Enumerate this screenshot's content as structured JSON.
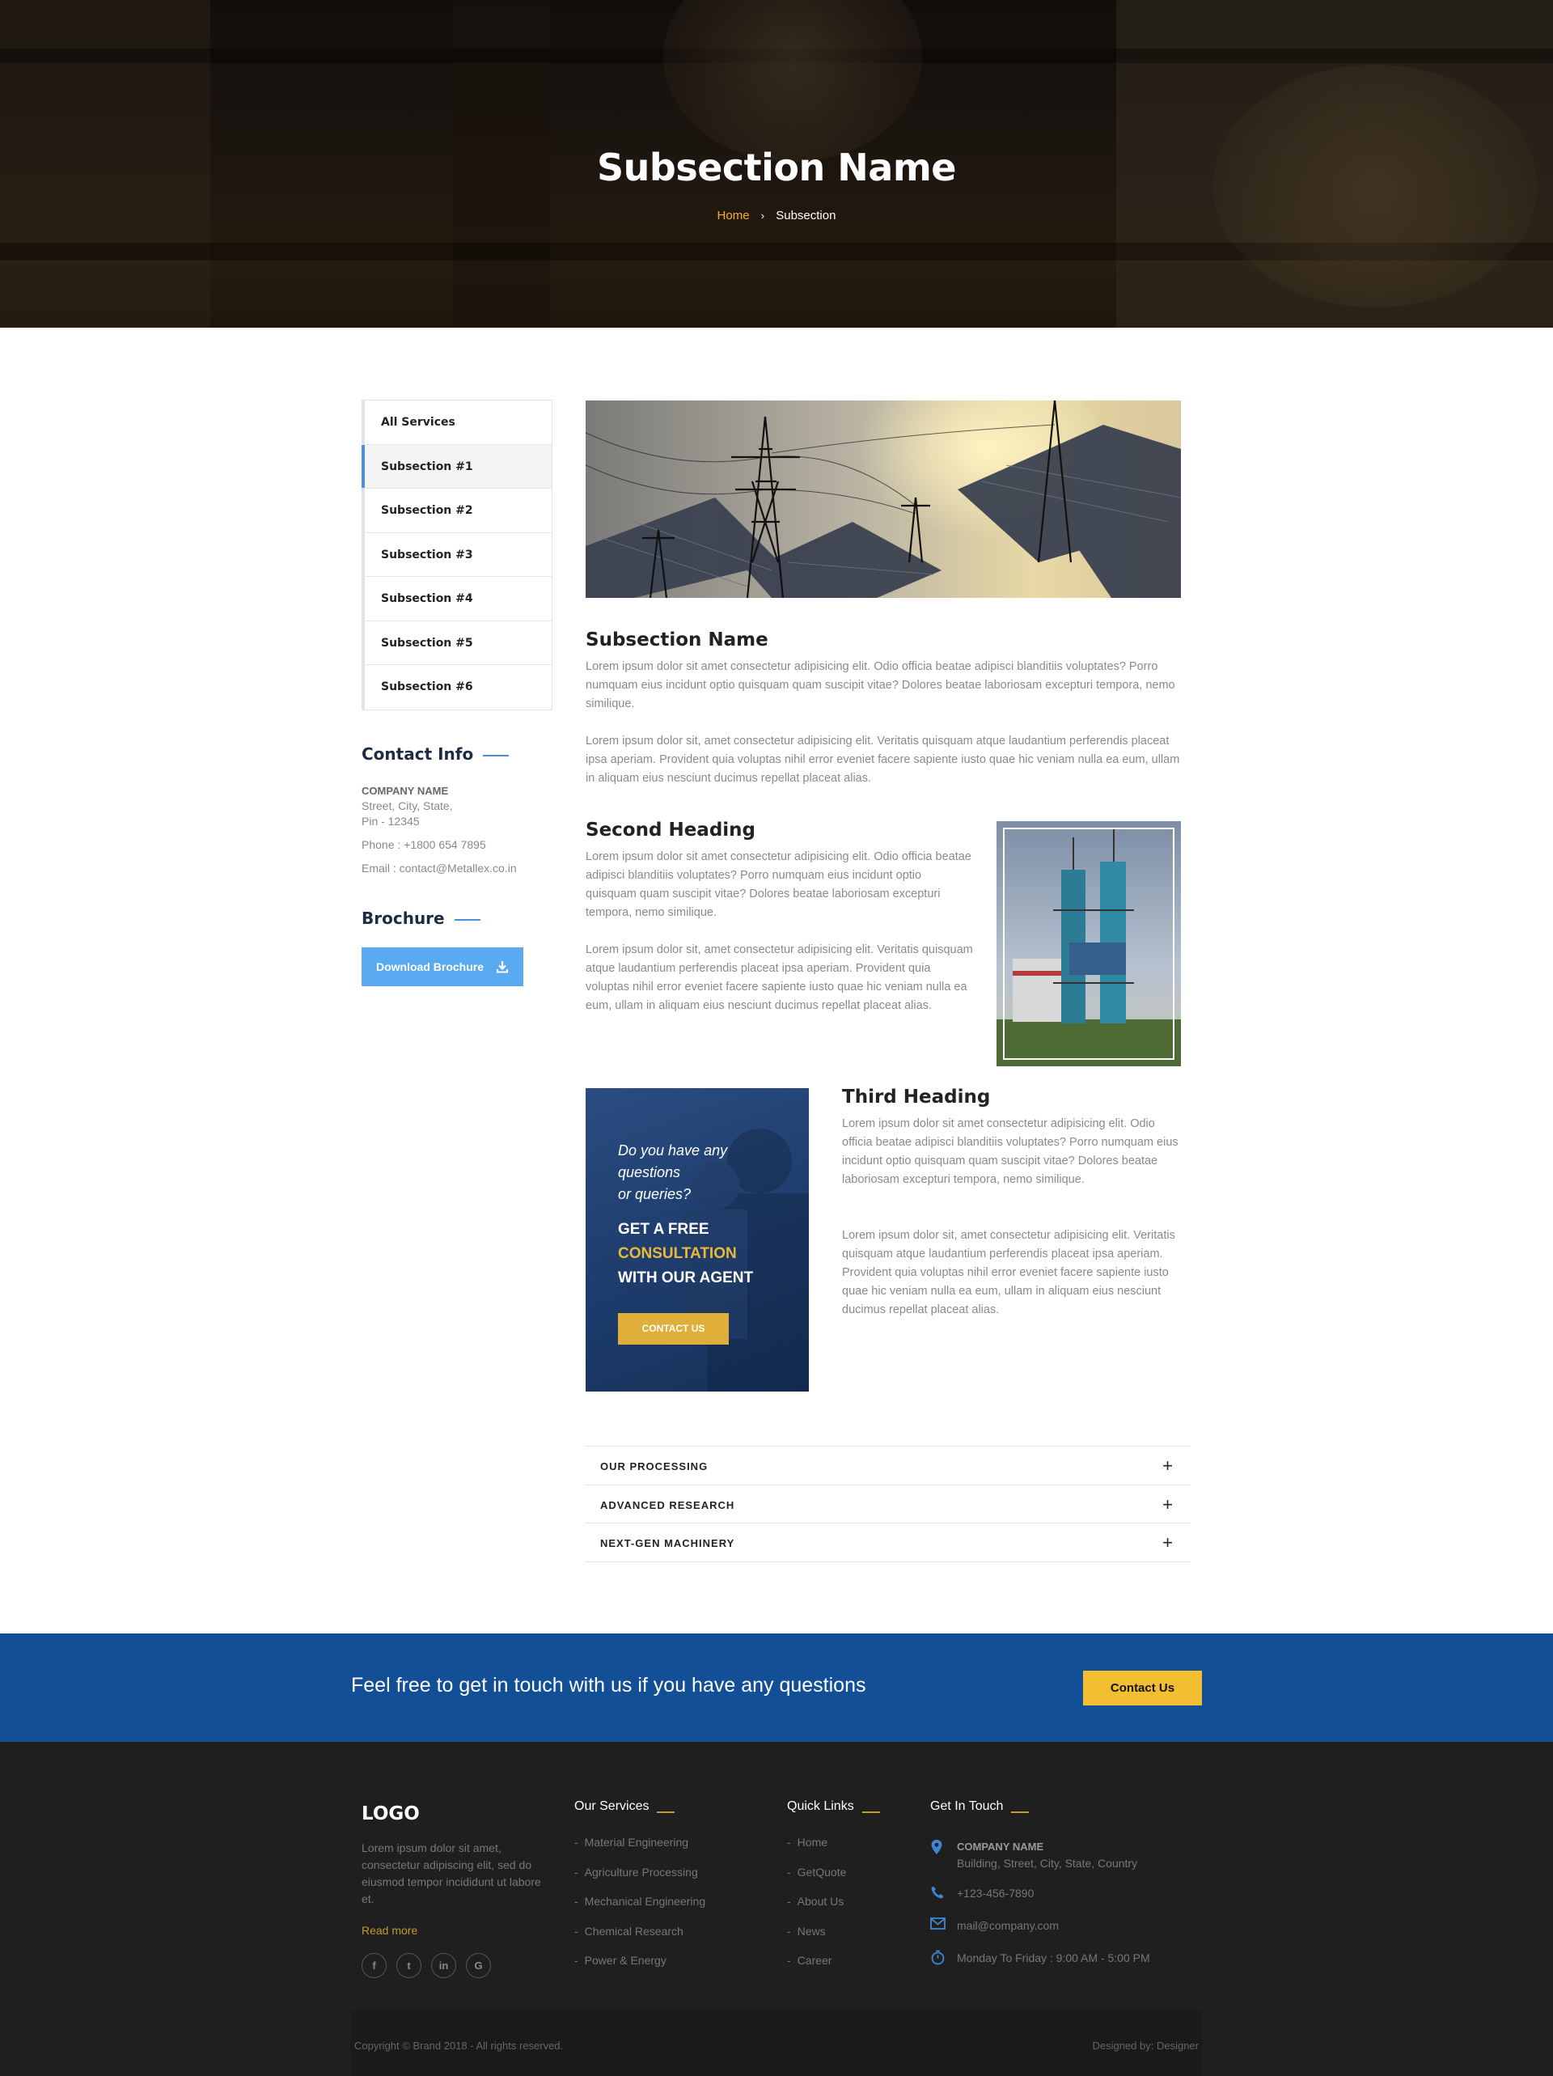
{
  "hero": {
    "title": "Subsection Name",
    "breadcrumb_home": "Home",
    "breadcrumb_separator": "›",
    "breadcrumb_current": "Subsection"
  },
  "sidebar": {
    "services": [
      "All Services",
      "Subsection #1",
      "Subsection #2",
      "Subsection #3",
      "Subsection #4",
      "Subsection #5",
      "Subsection #6"
    ],
    "active_index": 1,
    "contact_heading": "Contact Info",
    "company_name": "COMPANY NAME",
    "address_line1": "Street, City, State,",
    "address_line2": "Pin - 12345",
    "phone": "Phone : +1800 654 7895",
    "email": "Email : contact@Metallex.co.in",
    "brochure_heading": "Brochure",
    "download_label": "Download Brochure"
  },
  "main": {
    "section1": {
      "heading": "Subsection Name",
      "para1": "Lorem ipsum dolor sit amet consectetur adipisicing elit. Odio officia beatae adipisci blanditiis voluptates? Porro numquam eius incidunt optio quisquam quam suscipit vitae? Dolores beatae laboriosam excepturi tempora, nemo similique.",
      "para2": "Lorem ipsum dolor sit, amet consectetur adipisicing elit. Veritatis quisquam atque laudantium perferendis placeat ipsa aperiam. Provident quia voluptas nihil error eveniet facere sapiente iusto quae hic veniam nulla ea eum, ullam in aliquam eius nesciunt ducimus repellat placeat alias."
    },
    "section2": {
      "heading": "Second Heading",
      "para1": "Lorem ipsum dolor sit amet consectetur adipisicing elit. Odio officia beatae adipisci blanditiis voluptates? Porro numquam eius incidunt optio quisquam quam suscipit vitae? Dolores beatae laboriosam excepturi tempora, nemo similique.",
      "para2": "Lorem ipsum dolor sit, amet consectetur adipisicing elit. Veritatis quisquam atque laudantium perferendis placeat ipsa aperiam. Provident quia voluptas nihil error eveniet facere sapiente iusto quae hic veniam nulla ea eum, ullam in aliquam eius nesciunt ducimus repellat placeat alias."
    },
    "section3": {
      "heading": "Third Heading",
      "para1": "Lorem ipsum dolor sit amet consectetur adipisicing elit. Odio officia beatae adipisci blanditiis voluptates? Porro numquam eius incidunt optio quisquam quam suscipit vitae? Dolores beatae laboriosam excepturi tempora, nemo similique.",
      "para2": "Lorem ipsum dolor sit, amet consectetur adipisicing elit. Veritatis quisquam atque laudantium perferendis placeat ipsa aperiam. Provident quia voluptas nihil error eveniet facere sapiente iusto quae hic veniam nulla ea eum, ullam in aliquam eius nesciunt ducimus repellat placeat alias."
    },
    "cta": {
      "question_line1": "Do you have any",
      "question_line2": "questions",
      "question_line3": "or queries?",
      "offer_line1": "GET A FREE",
      "offer_line2": "CONSULTATION",
      "offer_line3": "WITH OUR AGENT",
      "button": "CONTACT US"
    },
    "accordion": [
      "OUR PROCESSING",
      "ADVANCED RESEARCH",
      "NEXT-GEN MACHINERY"
    ],
    "accordion_icon": "+"
  },
  "band": {
    "text": "Feel free to get in touch with us if you have any questions",
    "button": "Contact Us"
  },
  "footer": {
    "logo": "LOGO",
    "about": "Lorem ipsum dolor sit amet, consectetur adipiscing elit, sed do eiusmod tempor incididunt ut labore et.",
    "read_more": "Read more",
    "socials": [
      "f",
      "t",
      "in",
      "G"
    ],
    "services_heading": "Our Services",
    "services": [
      "Material Engineering",
      "Agriculture Processing",
      "Mechanical Engineering",
      "Chemical Research",
      "Power & Energy"
    ],
    "links_heading": "Quick Links",
    "links": [
      "Home",
      "GetQuote",
      "About Us",
      "News",
      "Career"
    ],
    "touch_heading": "Get In Touch",
    "company_name": "COMPANY NAME",
    "address": "Building, Street, City, State, Country",
    "phone": "+123-456-7890",
    "email": "mail@company.com",
    "hours": "Monday To Friday : 9:00 AM - 5:00 PM",
    "copyright": "Copyright © Brand 2018 - All rights reserved.",
    "designed_by": "Designed by: Designer"
  },
  "colors": {
    "accent_blue": "#4a90e2",
    "band_blue": "#124f96",
    "gold": "#f2bf31",
    "footer_bg": "#1f1f1f"
  }
}
